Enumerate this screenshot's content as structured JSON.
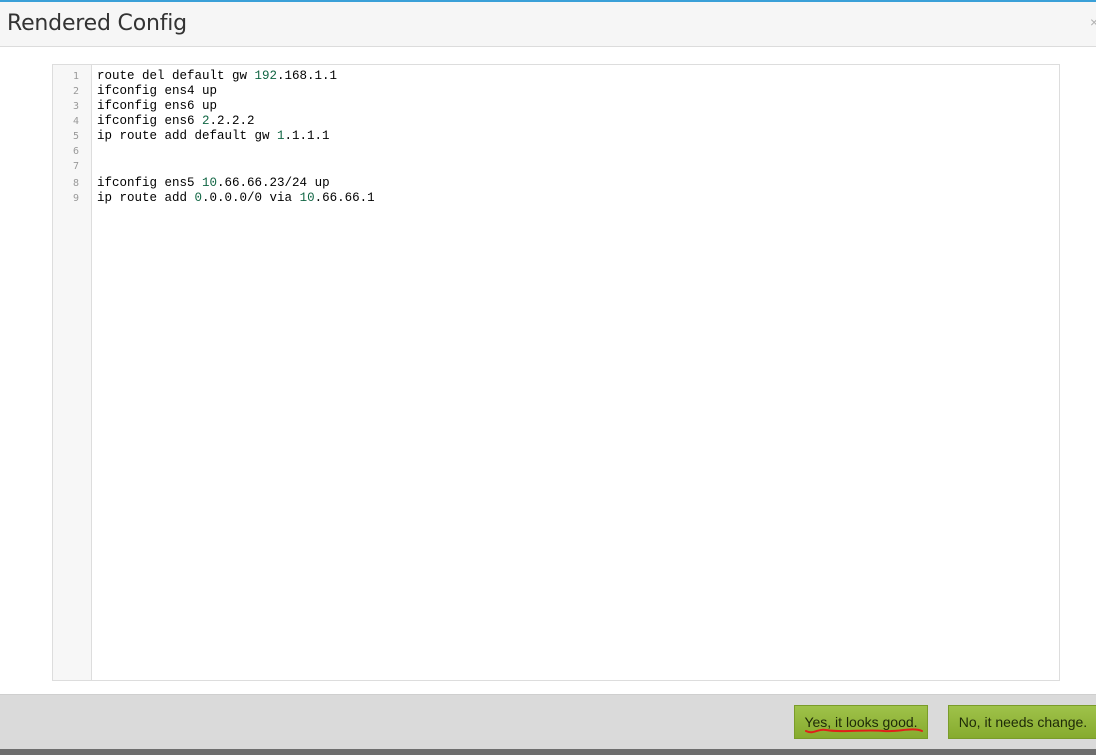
{
  "dialog": {
    "title": "Rendered Config",
    "close_label": "×"
  },
  "editor": {
    "lines": [
      {
        "number": "1",
        "segments": [
          {
            "text": "route del default gw ",
            "kind": "plain"
          },
          {
            "text": "192",
            "kind": "num"
          },
          {
            "text": ".168.1.1",
            "kind": "plain"
          }
        ]
      },
      {
        "number": "2",
        "segments": [
          {
            "text": "ifconfig ens4 up",
            "kind": "plain"
          }
        ]
      },
      {
        "number": "3",
        "segments": [
          {
            "text": "ifconfig ens6 up",
            "kind": "plain"
          }
        ]
      },
      {
        "number": "4",
        "segments": [
          {
            "text": "ifconfig ens6 ",
            "kind": "plain"
          },
          {
            "text": "2",
            "kind": "num"
          },
          {
            "text": ".2.2.2",
            "kind": "plain"
          }
        ]
      },
      {
        "number": "5",
        "segments": [
          {
            "text": "ip route add default gw ",
            "kind": "plain"
          },
          {
            "text": "1",
            "kind": "num"
          },
          {
            "text": ".1.1.1",
            "kind": "plain"
          }
        ]
      },
      {
        "number": "6",
        "segments": []
      },
      {
        "number": "7",
        "segments": []
      },
      {
        "number": "8",
        "segments": [
          {
            "text": "ifconfig ens5 ",
            "kind": "plain"
          },
          {
            "text": "10",
            "kind": "num"
          },
          {
            "text": ".66.66.23/24 up",
            "kind": "plain"
          }
        ]
      },
      {
        "number": "9",
        "segments": [
          {
            "text": "ip route add ",
            "kind": "plain"
          },
          {
            "text": "0",
            "kind": "num"
          },
          {
            "text": ".0.0.0/0 via ",
            "kind": "plain"
          },
          {
            "text": "10",
            "kind": "num"
          },
          {
            "text": ".66.66.1",
            "kind": "plain"
          }
        ]
      }
    ]
  },
  "footer": {
    "confirm_label": "Yes, it looks good.",
    "reject_label": "No, it needs change."
  },
  "colors": {
    "number_token": "#116644",
    "button_green": "#9fc24a",
    "annotation_red": "#e0201a",
    "top_accent": "#3aa0d8"
  }
}
